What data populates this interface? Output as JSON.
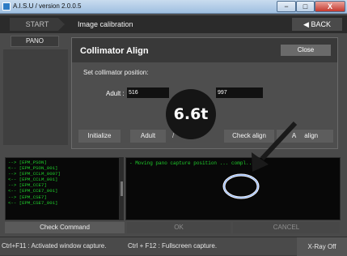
{
  "window": {
    "title": "A.I.S.U / version 2.0.0.5",
    "minimize": "−",
    "maximize": "□",
    "close": "X"
  },
  "nav": {
    "start": "START",
    "breadcrumb": "Image calibration",
    "back": "BACK",
    "back_icon": "◀"
  },
  "pano_tab": "PANO",
  "dialog": {
    "title": "Collimator Align",
    "close": "Close",
    "instruction": "Set collimator position:",
    "adult_label": "Adult :",
    "field1_value": "516",
    "field2_value": "997",
    "buttons": [
      "Initialize",
      "Adult",
      "/",
      "Check align",
      "A",
      "align"
    ]
  },
  "timer_badge": "6.6t",
  "log_left": [
    "--> [EPM_PSON]",
    "<-- [EPM_PSON_001]",
    "--> [EPM_CCLM_0007]",
    "<-- [EPM_CCLM_001]",
    "--> [EPM_CCE7]",
    "<-- [EPM_CCE7_001]",
    "--> [EPM_CSE7]",
    "<-- [EPM_CSE7_001]"
  ],
  "log_right": "- Moving pano capture position ...   compl...",
  "buttons": {
    "check_command": "Check Command",
    "ok": "OK",
    "cancel": "CANCEL"
  },
  "status": {
    "left": "Ctrl+F11 : Activated window capture.",
    "right": "Ctrl + F12 : Fullscreen capture.",
    "xray": "X-Ray Off"
  },
  "colors": {
    "log_text": "#1fcc2b",
    "annotation": "#1a1a1a",
    "highlight_ring": "#8fb4ff"
  }
}
